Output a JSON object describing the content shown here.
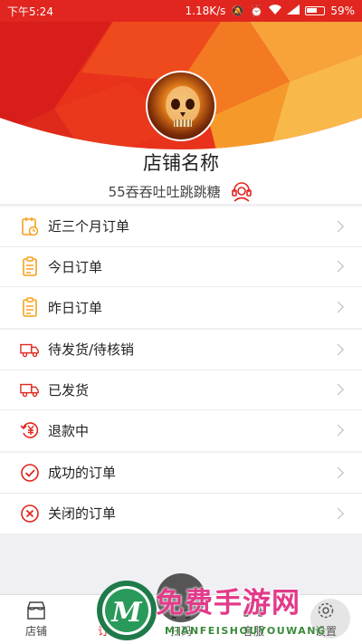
{
  "status_bar": {
    "time": "下午5:24",
    "speed": "1.18K/s",
    "battery": "59%"
  },
  "header": {
    "shop_name": "店铺名称",
    "shop_subtitle": "55吞吞吐吐跳跳糖"
  },
  "sections": [
    {
      "items": [
        {
          "label": "近三个月订单",
          "icon": "calendar-clock-icon"
        },
        {
          "label": "今日订单",
          "icon": "clipboard-icon"
        },
        {
          "label": "昨日订单",
          "icon": "clipboard-icon"
        }
      ]
    },
    {
      "items": [
        {
          "label": "待发货/待核销",
          "icon": "truck-icon"
        },
        {
          "label": "已发货",
          "icon": "truck-icon"
        },
        {
          "label": "退款中",
          "icon": "refund-yen-icon"
        }
      ]
    },
    {
      "items": [
        {
          "label": "成功的订单",
          "icon": "check-circle-icon"
        },
        {
          "label": "关闭的订单",
          "icon": "x-circle-icon"
        }
      ]
    }
  ],
  "nav": [
    {
      "label": "店铺",
      "icon": "store-icon",
      "active": false
    },
    {
      "label": "订单",
      "icon": "order-icon",
      "active": true
    },
    {
      "label": "扫码",
      "icon": "scan-icon",
      "active": false
    },
    {
      "label": "客服",
      "icon": "headset-icon",
      "active": false
    },
    {
      "label": "设置",
      "icon": "gear-icon",
      "active": false
    }
  ],
  "watermark": {
    "title": "免费手游网",
    "subtitle": "MIANFEISHOUYOUWANG",
    "logo_letter": "M"
  },
  "colors": {
    "accent": "#e0261f",
    "orange": "#f5a21d"
  }
}
